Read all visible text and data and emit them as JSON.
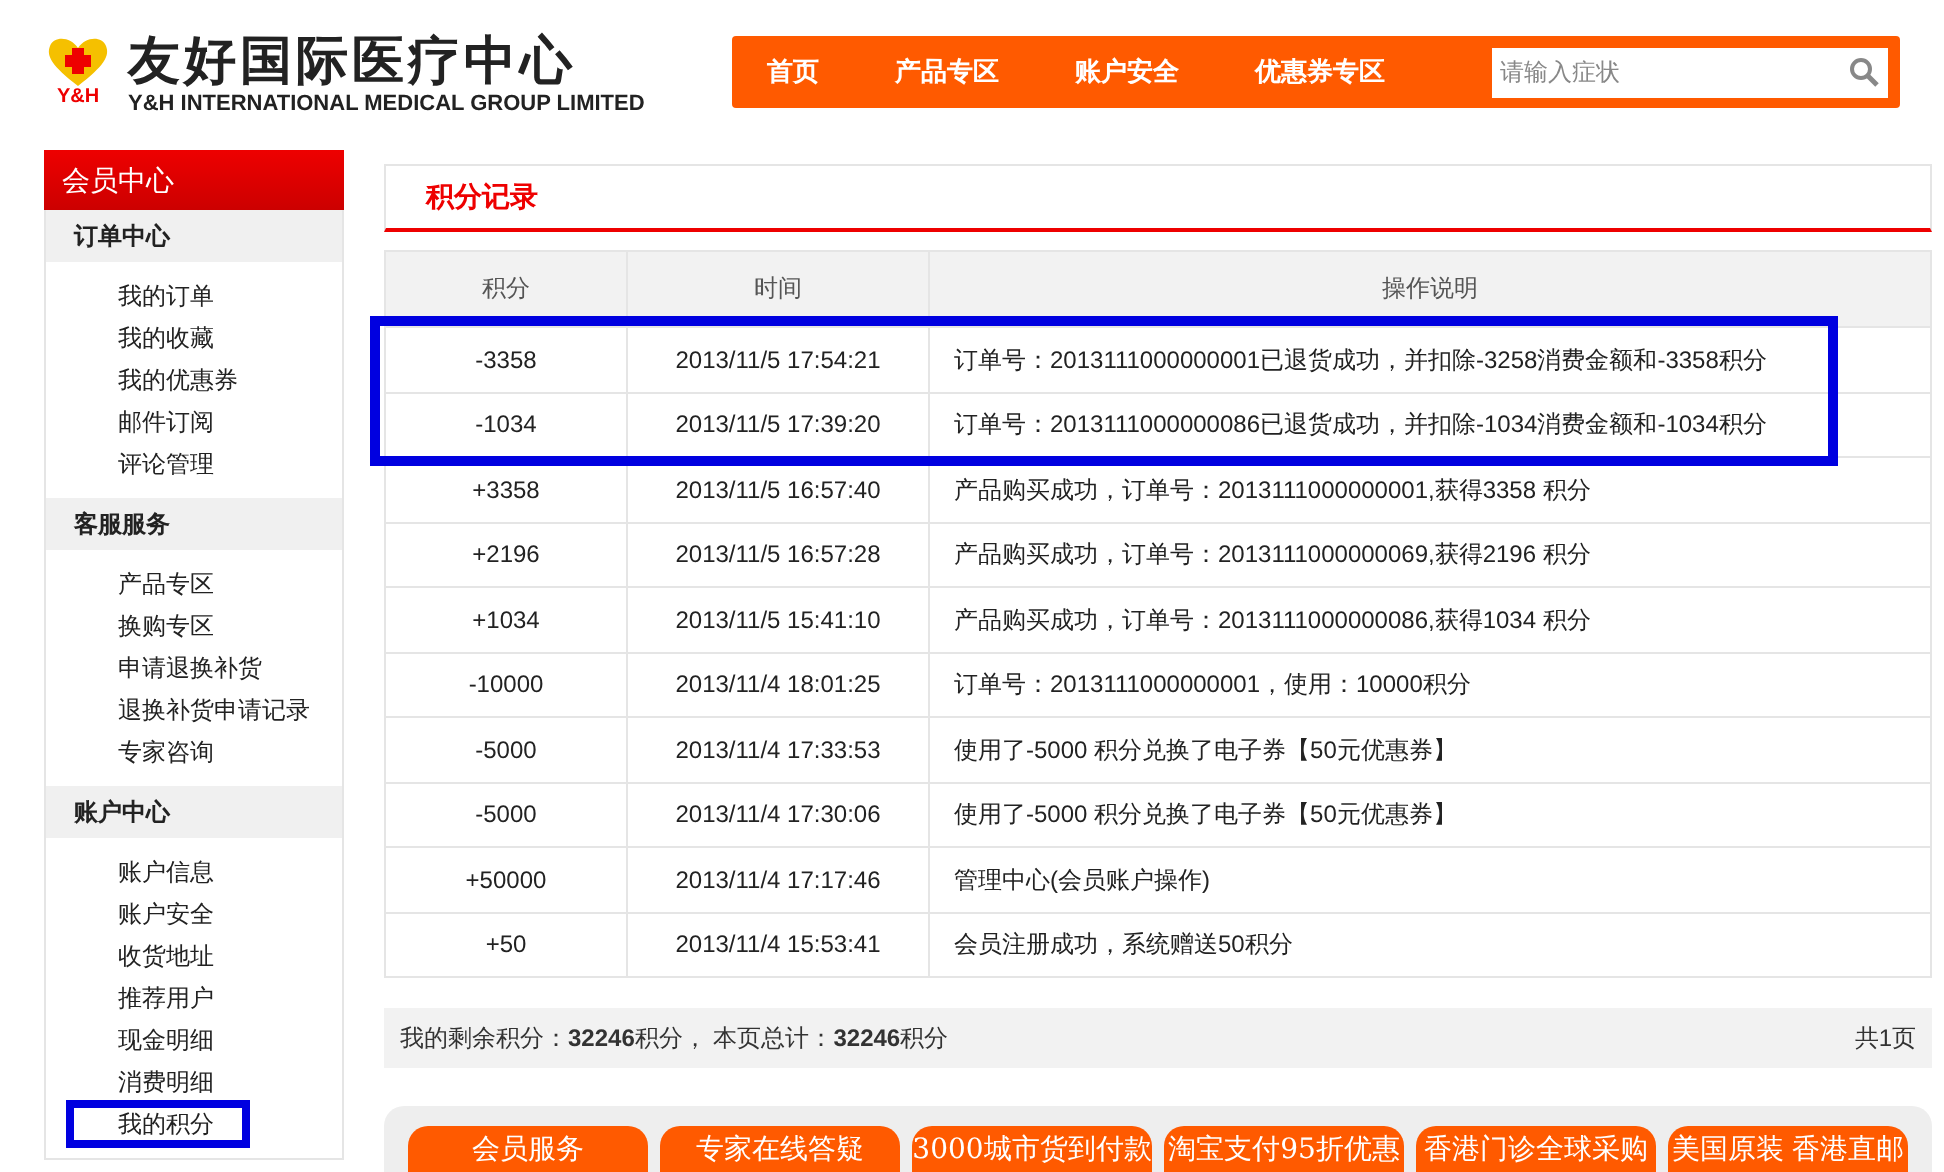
{
  "logo": {
    "mark": "Y&H",
    "title": "友好国际医疗中心",
    "subtitle": "Y&H INTERNATIONAL MEDICAL GROUP LIMITED"
  },
  "nav": {
    "items": [
      "首页",
      "产品专区",
      "账户安全",
      "优惠券专区"
    ],
    "search": {
      "placeholder": "请输入症状"
    }
  },
  "sidebar": {
    "title": "会员中心",
    "sections": [
      {
        "title": "订单中心",
        "items": [
          {
            "label": "我的订单",
            "highlighted": false
          },
          {
            "label": "我的收藏",
            "highlighted": false
          },
          {
            "label": "我的优惠券",
            "highlighted": false
          },
          {
            "label": "邮件订阅",
            "highlighted": false
          },
          {
            "label": "评论管理",
            "highlighted": false
          }
        ]
      },
      {
        "title": "客服服务",
        "items": [
          {
            "label": "产品专区",
            "highlighted": false
          },
          {
            "label": "换购专区",
            "highlighted": false
          },
          {
            "label": "申请退换补货",
            "highlighted": false
          },
          {
            "label": "退换补货申请记录",
            "highlighted": false
          },
          {
            "label": "专家咨询",
            "highlighted": false
          }
        ]
      },
      {
        "title": "账户中心",
        "items": [
          {
            "label": "账户信息",
            "highlighted": false
          },
          {
            "label": "账户安全",
            "highlighted": false
          },
          {
            "label": "收货地址",
            "highlighted": false
          },
          {
            "label": "推荐用户",
            "highlighted": false
          },
          {
            "label": "现金明细",
            "highlighted": false
          },
          {
            "label": "消费明细",
            "highlighted": false
          },
          {
            "label": "我的积分",
            "highlighted": true
          }
        ]
      }
    ]
  },
  "panel": {
    "title": "积分记录"
  },
  "table": {
    "columns": [
      "积分",
      "时间",
      "操作说明"
    ],
    "rows": [
      {
        "points": "-3358",
        "time": "2013/11/5 17:54:21",
        "description": "订单号：2013111000000001已退货成功，并扣除-3258消费金额和-3358积分",
        "highlighted": true
      },
      {
        "points": "-1034",
        "time": "2013/11/5 17:39:20",
        "description": "订单号：2013111000000086已退货成功，并扣除-1034消费金额和-1034积分",
        "highlighted": true
      },
      {
        "points": "+3358",
        "time": "2013/11/5 16:57:40",
        "description": "产品购买成功，订单号：2013111000000001,获得3358 积分",
        "highlighted": false
      },
      {
        "points": "+2196",
        "time": "2013/11/5 16:57:28",
        "description": "产品购买成功，订单号：2013111000000069,获得2196 积分",
        "highlighted": false
      },
      {
        "points": "+1034",
        "time": "2013/11/5 15:41:10",
        "description": "产品购买成功，订单号：2013111000000086,获得1034 积分",
        "highlighted": false
      },
      {
        "points": "-10000",
        "time": "2013/11/4 18:01:25",
        "description": "订单号：2013111000000001，使用：10000积分",
        "highlighted": false
      },
      {
        "points": "-5000",
        "time": "2013/11/4 17:33:53",
        "description": "使用了-5000 积分兑换了电子券【50元优惠券】",
        "highlighted": false
      },
      {
        "points": "-5000",
        "time": "2013/11/4 17:30:06",
        "description": "使用了-5000 积分兑换了电子券【50元优惠券】",
        "highlighted": false
      },
      {
        "points": "+50000",
        "time": "2013/11/4 17:17:46",
        "description": "管理中心(会员账户操作)",
        "highlighted": false
      },
      {
        "points": "+50",
        "time": "2013/11/4 15:53:41",
        "description": "会员注册成功，系统赠送50积分",
        "highlighted": false
      }
    ]
  },
  "summary": {
    "text": "我的剩余积分：**32246**积分， 本页总计：**32246**积分",
    "pages": "共1页"
  },
  "footer_buttons": [
    "会员服务",
    "专家在线答疑",
    "3000城市货到付款",
    "淘宝支付95折优惠",
    "香港门诊全球采购",
    "美国原装 香港直邮"
  ]
}
